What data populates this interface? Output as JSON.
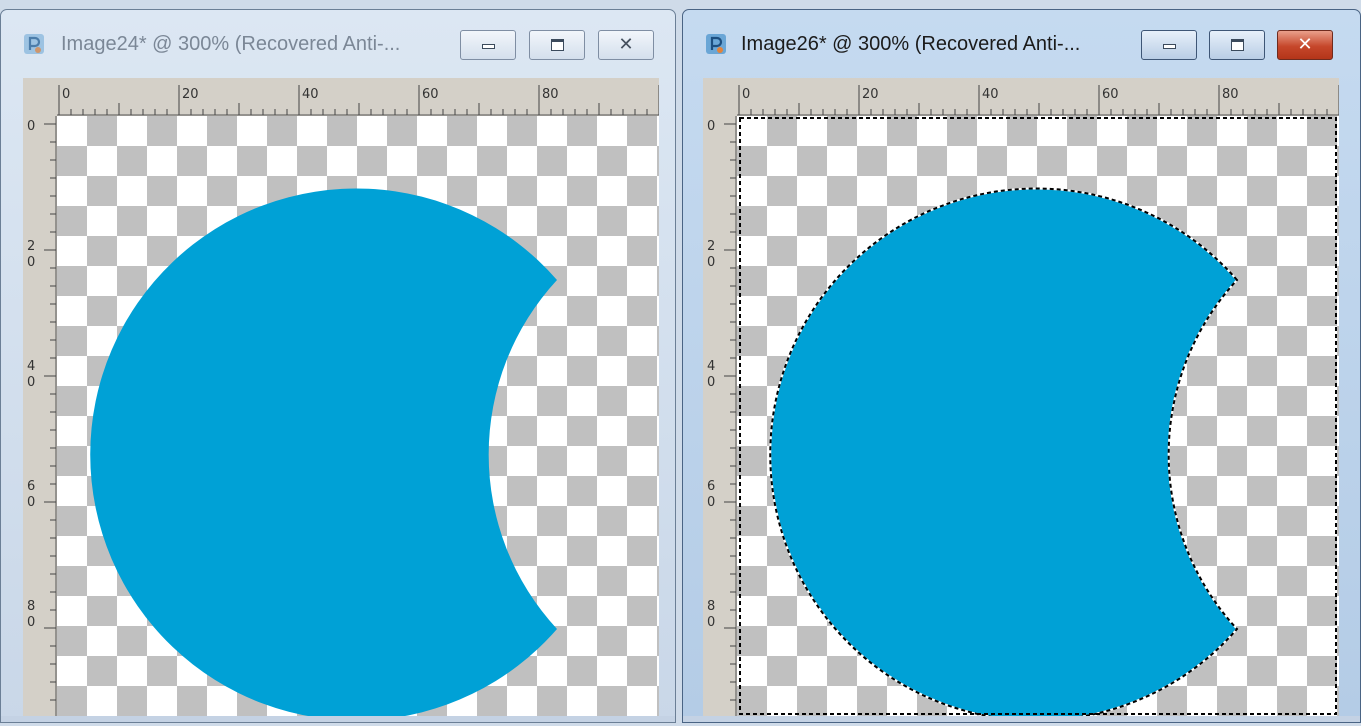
{
  "windows": [
    {
      "title": "Image24* @ 300% (Recovered Anti-...",
      "active": false,
      "selection": false,
      "icons": {
        "app": "paintshop-pro-icon",
        "minimize": "minimize-icon",
        "maximize": "maximize-icon",
        "close": "close-icon"
      }
    },
    {
      "title": "Image26* @ 300% (Recovered Anti-...",
      "active": true,
      "selection": true,
      "icons": {
        "app": "paintshop-pro-icon",
        "minimize": "minimize-icon",
        "maximize": "maximize-icon",
        "close": "close-icon"
      }
    }
  ],
  "ruler": {
    "horizontal_labels": [
      "0",
      "20",
      "40",
      "60",
      "80"
    ],
    "vertical_labels": [
      [
        "0"
      ],
      [
        "2",
        "0"
      ],
      [
        "4",
        "0"
      ],
      [
        "6",
        "0"
      ],
      [
        "8",
        "0"
      ]
    ]
  },
  "close_glyph": "✕",
  "colors": {
    "shape_fill": "#00a1d6",
    "checker_light": "#ffffff",
    "checker_dark": "#c0c0c0",
    "ruler_bg": "#d4d0c8"
  }
}
